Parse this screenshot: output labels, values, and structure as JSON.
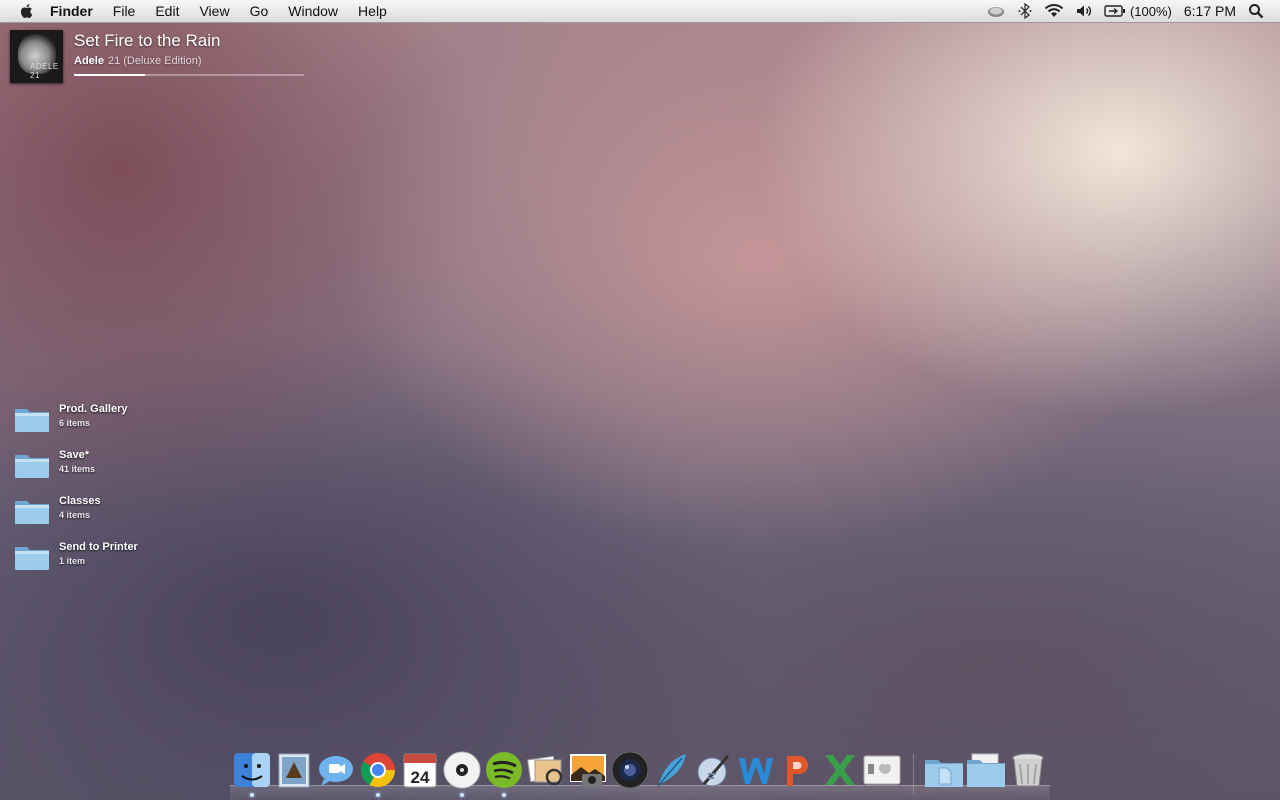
{
  "menubar": {
    "app_name": "Finder",
    "items": [
      "File",
      "Edit",
      "View",
      "Go",
      "Window",
      "Help"
    ],
    "battery": "(100%)",
    "clock": "6:17 PM",
    "status_icons": [
      "cloud-icon",
      "bluetooth-icon",
      "wifi-icon",
      "volume-icon",
      "battery-icon",
      "spotlight-icon"
    ]
  },
  "now_playing": {
    "title": "Set Fire to the Rain",
    "artist": "Adele",
    "album": "21 (Deluxe Edition)",
    "art_text": "ADELE 21",
    "progress_fraction": 0.31
  },
  "desktop": {
    "folders": [
      {
        "name": "Prod. Gallery",
        "count": "6 items"
      },
      {
        "name": "Save*",
        "count": "41 items"
      },
      {
        "name": "Classes",
        "count": "4 items"
      },
      {
        "name": "Send to Printer",
        "count": "1 item"
      }
    ]
  },
  "dock": {
    "apps": [
      {
        "icon": "finder-icon",
        "running": true
      },
      {
        "icon": "mail-icon",
        "running": false
      },
      {
        "icon": "messages-icon",
        "running": false
      },
      {
        "icon": "chrome-icon",
        "running": true
      },
      {
        "icon": "calendar-icon",
        "running": false,
        "label": "24"
      },
      {
        "icon": "disc-icon",
        "running": true
      },
      {
        "icon": "spotify-icon",
        "running": true
      },
      {
        "icon": "preview-icon",
        "running": false
      },
      {
        "icon": "iphoto-icon",
        "running": false
      },
      {
        "icon": "aperture-icon",
        "running": false
      },
      {
        "icon": "feather-icon",
        "running": false
      },
      {
        "icon": "script-editor-icon",
        "running": false
      },
      {
        "icon": "word-icon",
        "running": false
      },
      {
        "icon": "powerpoint-icon",
        "running": false
      },
      {
        "icon": "excel-icon",
        "running": false
      },
      {
        "icon": "system-info-icon",
        "running": false
      },
      {
        "icon": "documents-stack-icon",
        "running": false
      },
      {
        "icon": "downloads-stack-icon",
        "running": false
      },
      {
        "icon": "trash-icon",
        "running": false
      }
    ]
  },
  "colors": {
    "menubar_bg": "#e9e9e9",
    "folder_blue": "#8ec1e6",
    "spotify_green": "#7bb928",
    "chrome_red": "#db4437",
    "word_blue": "#2b8ad8",
    "powerpoint_orange": "#e2572c",
    "excel_green": "#3aa14a"
  }
}
